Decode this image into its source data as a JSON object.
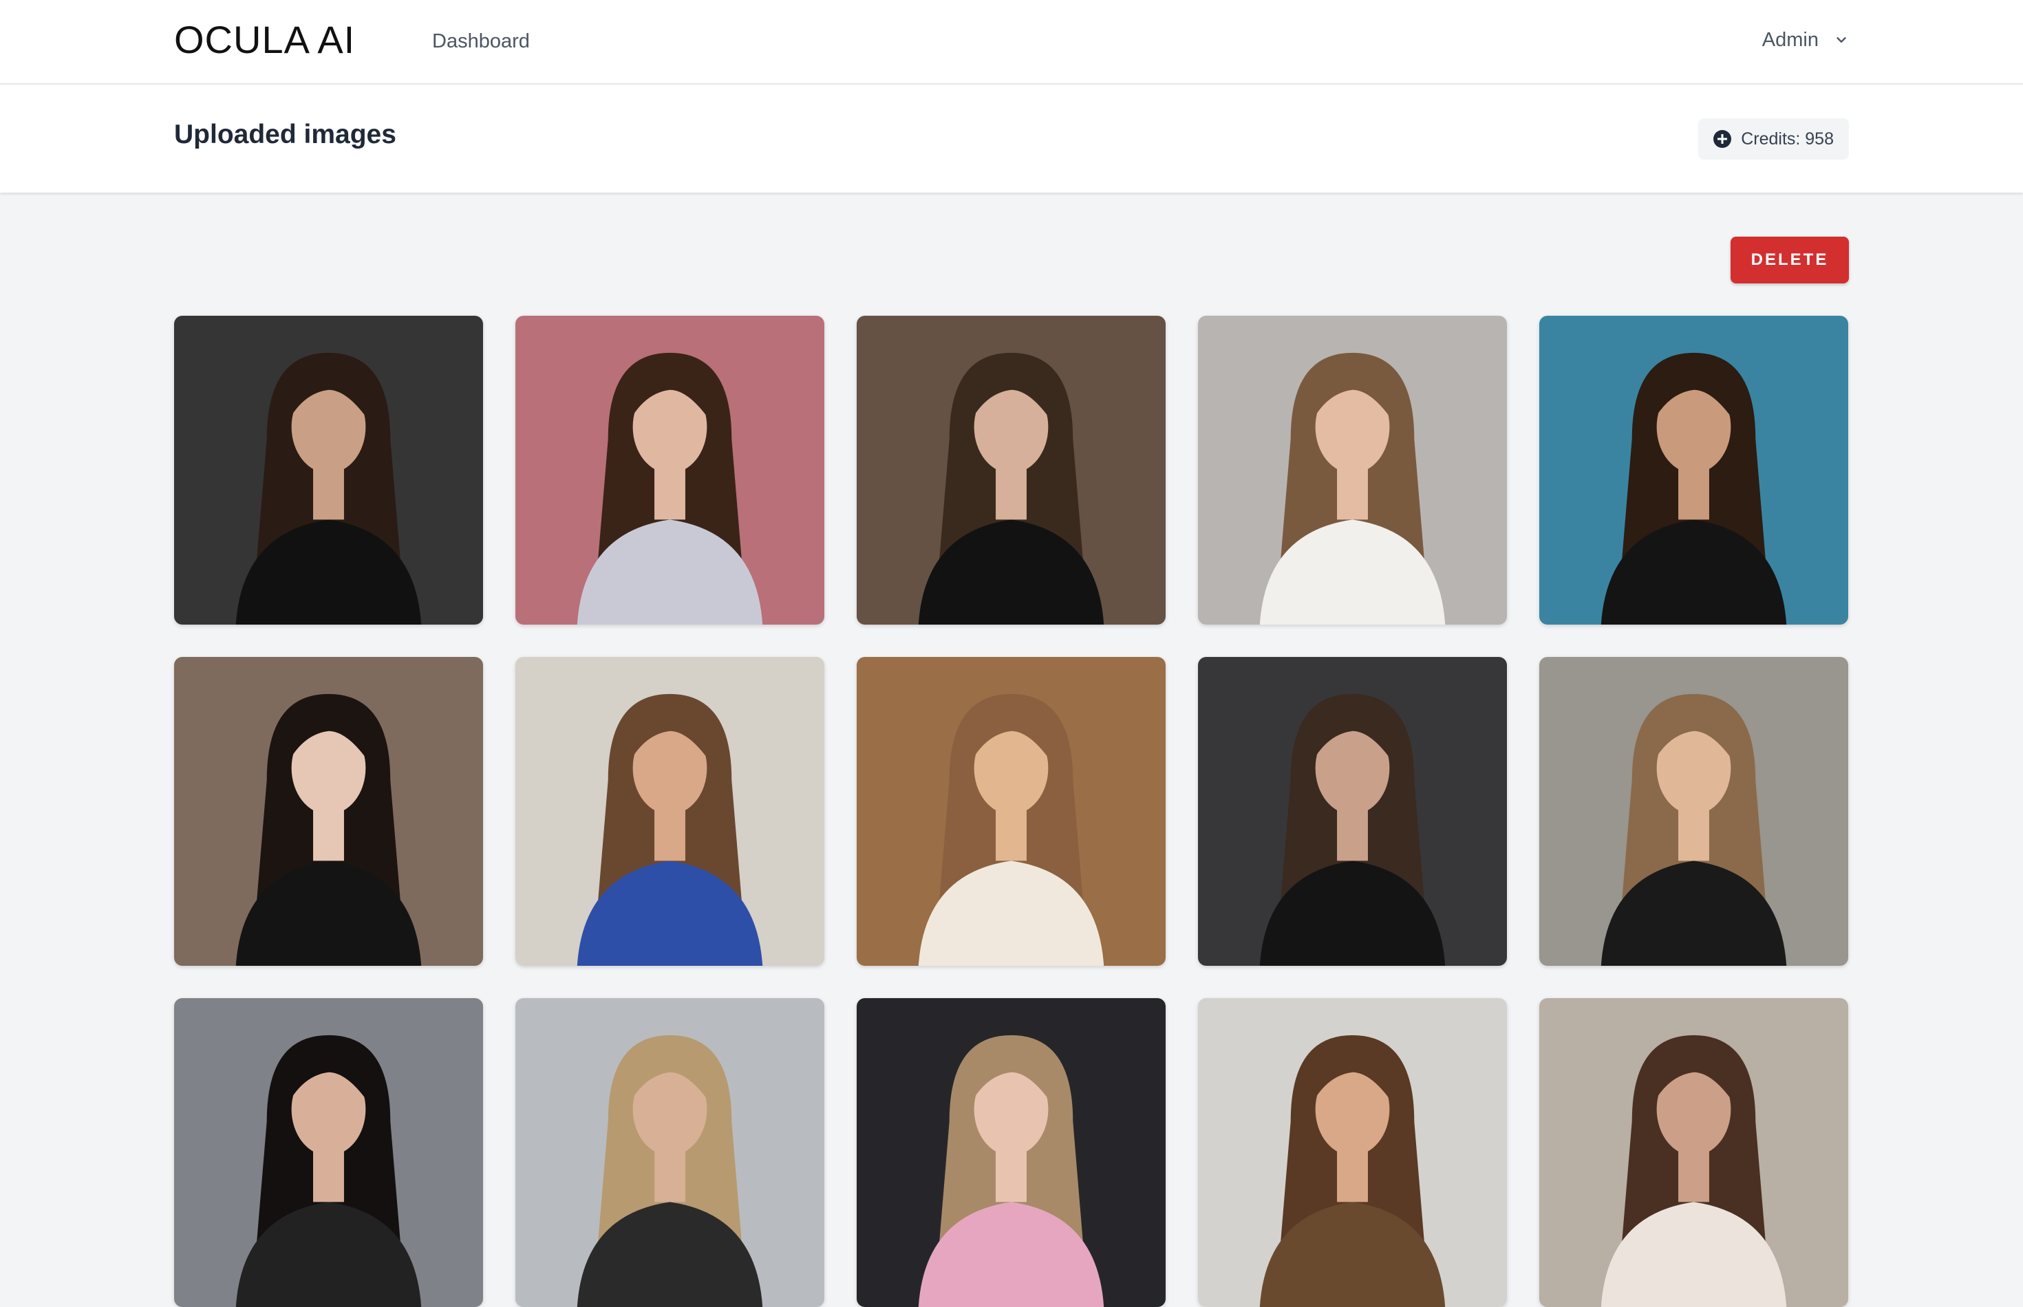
{
  "nav": {
    "logo": "OCULA AI",
    "links": [
      "Dashboard"
    ],
    "user": "Admin",
    "user_icon": "chevron-down-icon"
  },
  "header": {
    "title": "Uploaded images",
    "credits_label": "Credits: 958",
    "credits_icon": "plus-circle-icon"
  },
  "actions": {
    "delete_label": "DELETE",
    "delete_color": "#d32f2f"
  },
  "images": [
    {
      "bg": "#3b3a3a",
      "hair": "#2a1c14",
      "skin": "#c9a086",
      "top": "#111111"
    },
    {
      "bg": "#c97a84",
      "hair": "#3a2418",
      "skin": "#e0b8a2",
      "top": "#c9c9d6"
    },
    {
      "bg": "#6e5a4a",
      "hair": "#3a2a1e",
      "skin": "#d6b09a",
      "top": "#121212"
    },
    {
      "bg": "#c8c4c1",
      "hair": "#7a5a3e",
      "skin": "#e4bca3",
      "top": "#f2f0ed"
    },
    {
      "bg": "#3f90b0",
      "hair": "#2c1c12",
      "skin": "#c99a7c",
      "top": "#141414"
    },
    {
      "bg": "#8a7466",
      "hair": "#1c1410",
      "skin": "#e6c6b4",
      "top": "#141414"
    },
    {
      "bg": "#e8e2da",
      "hair": "#6a4830",
      "skin": "#d8a888",
      "top": "#2e4fa8"
    },
    {
      "bg": "#a8784c",
      "hair": "#8a6040",
      "skin": "#e2b68e",
      "top": "#f0e8dc"
    },
    {
      "bg": "#3c3c3e",
      "hair": "#3a2a20",
      "skin": "#c9a08a",
      "top": "#141414"
    },
    {
      "bg": "#a6a29c",
      "hair": "#8a6a4a",
      "skin": "#e0b898",
      "top": "#1a1a1a"
    },
    {
      "bg": "#8a8e94",
      "hair": "#141010",
      "skin": "#d8b09a",
      "top": "#222222"
    },
    {
      "bg": "#c8ccd2",
      "hair": "#b89a70",
      "skin": "#d8b096",
      "top": "#2a2a2a"
    },
    {
      "bg": "#2a2a2e",
      "hair": "#a88a68",
      "skin": "#e8c4b0",
      "top": "#e6a6c0"
    },
    {
      "bg": "#e6e4e0",
      "hair": "#5a3a24",
      "skin": "#d8a888",
      "top": "#6a4a2e"
    },
    {
      "bg": "#c8beb4",
      "hair": "#4a3022",
      "skin": "#cca088",
      "top": "#ece4dc"
    }
  ]
}
